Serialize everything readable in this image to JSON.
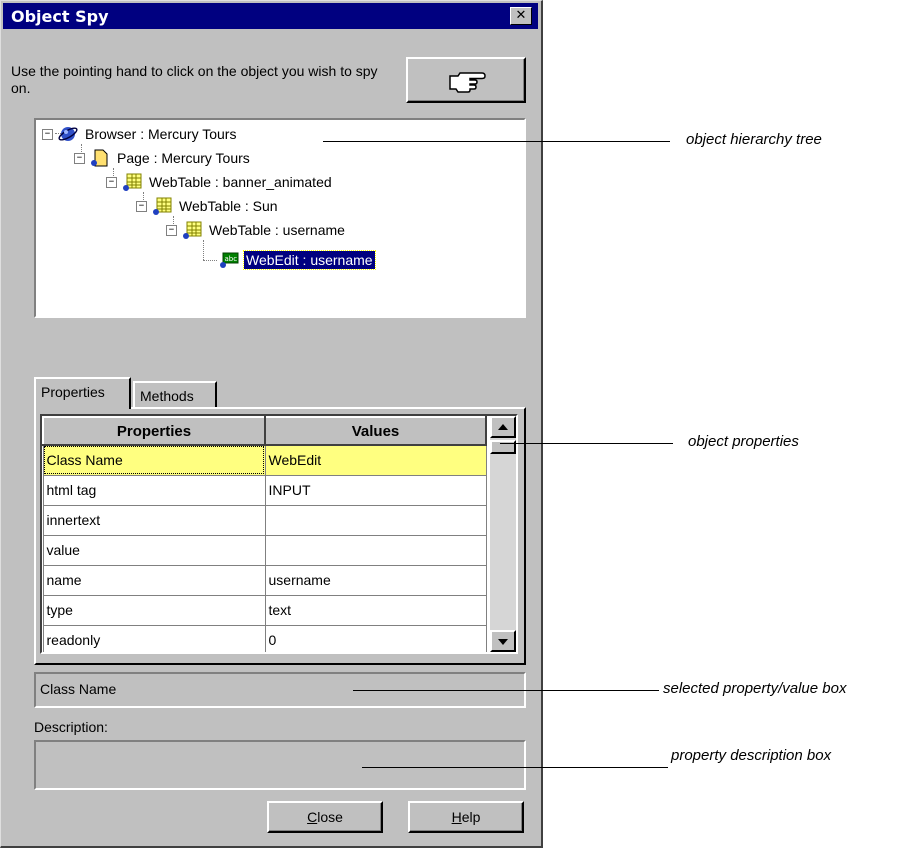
{
  "window": {
    "title": "Object Spy",
    "close_glyph": "✕"
  },
  "instruction": "Use the pointing hand to click on the object you wish to spy on.",
  "pointer_button": {
    "icon": "pointing-hand-icon"
  },
  "tree": {
    "nodes": [
      {
        "label": "Browser : Mercury Tours",
        "icon": "browser-icon",
        "expander": "−"
      },
      {
        "label": "Page : Mercury Tours",
        "icon": "page-icon",
        "expander": "−"
      },
      {
        "label": "WebTable : banner_animated",
        "icon": "webtable-icon",
        "expander": "−"
      },
      {
        "label": "WebTable : Sun",
        "icon": "webtable-icon",
        "expander": "−"
      },
      {
        "label": "WebTable : username",
        "icon": "webtable-icon",
        "expander": "−"
      },
      {
        "label": "WebEdit : username",
        "icon": "webedit-icon",
        "expander": "",
        "selected": true
      }
    ]
  },
  "tabs": [
    {
      "label": "Properties",
      "active": true
    },
    {
      "label": "Methods",
      "active": false
    }
  ],
  "grid": {
    "headers": [
      "Properties",
      "Values"
    ],
    "rows": [
      {
        "property": "Class Name",
        "value": "WebEdit",
        "highlighted": true
      },
      {
        "property": "html tag",
        "value": "INPUT"
      },
      {
        "property": "innertext",
        "value": ""
      },
      {
        "property": "value",
        "value": ""
      },
      {
        "property": "name",
        "value": "username"
      },
      {
        "property": "type",
        "value": "text"
      },
      {
        "property": "readonly",
        "value": "0"
      }
    ]
  },
  "selected_property": "Class Name",
  "description": {
    "label": "Description:",
    "text": ""
  },
  "buttons": {
    "close": {
      "mnemonic": "C",
      "rest": "lose"
    },
    "help": {
      "mnemonic": "H",
      "rest": "elp"
    }
  },
  "callouts": {
    "tree": "object hierarchy tree",
    "properties": "object properties",
    "selected_box": "selected property/value box",
    "description_box": "property description box"
  },
  "colors": {
    "dialog_bg": "#c0c0c0",
    "titlebar": "#000080",
    "selection": "#000080",
    "row_highlight": "#ffff80"
  }
}
